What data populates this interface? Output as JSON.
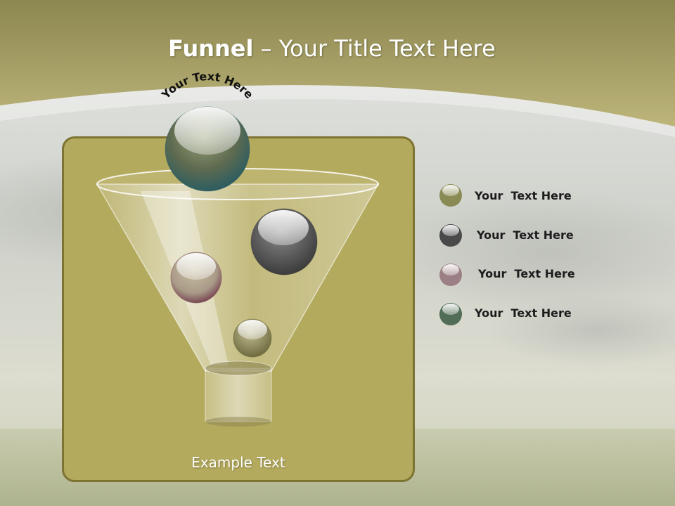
{
  "title": {
    "bold": "Funnel",
    "rest": " – Your Title Text Here"
  },
  "arc_label": "Your Text Here",
  "panel_label": "Example Text",
  "legend": [
    {
      "label": "Your  Text Here",
      "color": "#8a8a55",
      "icon": "olive-sphere-icon"
    },
    {
      "label": "Your  Text Here",
      "color": "#4a4a4a",
      "icon": "dark-gray-sphere-icon"
    },
    {
      "label": "Your  Text Here",
      "color": "#7a4a55",
      "icon": "maroon-sphere-icon"
    },
    {
      "label": "Your  Text Here",
      "color": "#2f5a5a",
      "icon": "teal-sphere-icon"
    }
  ],
  "colors": {
    "panel": "#b4aa5d",
    "panel_border": "#7d7332",
    "band": "#b8b06e"
  }
}
